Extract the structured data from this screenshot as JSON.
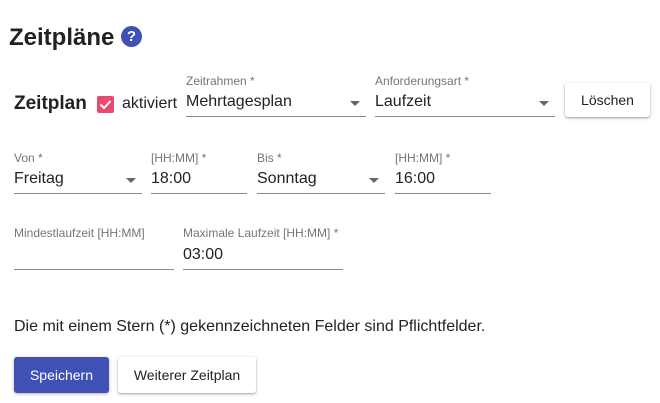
{
  "page": {
    "title": "Zeitpläne",
    "help_icon": "?"
  },
  "schedule": {
    "title": "Zeitplan",
    "enabled_label": "aktiviert",
    "enabled": true,
    "timeframe": {
      "label": "Zeitrahmen *",
      "value": "Mehrtagesplan"
    },
    "request_type": {
      "label": "Anforderungsart *",
      "value": "Laufzeit"
    },
    "delete_label": "Löschen",
    "from_day": {
      "label": "Von *",
      "value": "Freitag"
    },
    "from_time": {
      "label": "[HH:MM] *",
      "value": "18:00"
    },
    "to_day": {
      "label": "Bis *",
      "value": "Sonntag"
    },
    "to_time": {
      "label": "[HH:MM] *",
      "value": "16:00"
    },
    "min_runtime": {
      "label": "Mindestlaufzeit [HH:MM]",
      "value": ""
    },
    "max_runtime": {
      "label": "Maximale Laufzeit [HH:MM] *",
      "value": "03:00"
    }
  },
  "hint": "Die mit einem Stern (*) gekennzeichneten Felder sind Pflichtfelder.",
  "actions": {
    "save_label": "Speichern",
    "add_label": "Weiterer Zeitplan"
  },
  "colors": {
    "primary": "#3f51b5",
    "checkbox": "#e84a72"
  }
}
